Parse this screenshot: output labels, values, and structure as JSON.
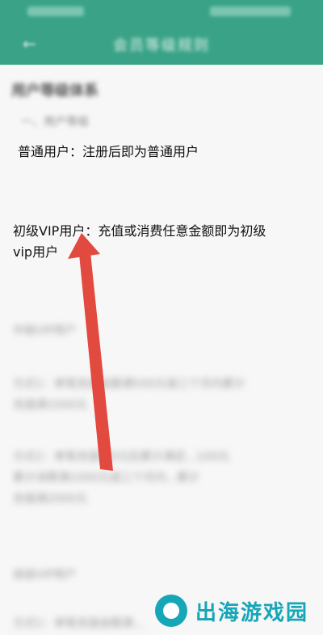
{
  "app": {
    "title": "会员等级规则"
  },
  "content": {
    "section_title": "用户等级体系",
    "subsection": "一、用户等级",
    "normal_user": "普通用户：注册后即为普通用户",
    "vip1_line1": "初级VIP用户：充值或消费任意金额即为初级",
    "vip1_line2": "vip用户",
    "mid_vip": "中级VIP用户",
    "rule1_line1": "方式1：单笔充值金额满500元或三个月内累计",
    "rule1_line2": "充值满1000元",
    "rule2_line1": "方式2：单笔充值满3元后累计满足...100元",
    "rule2_line2": "累计消费满1000元或三个月内...累计",
    "rule2_line3": "充值满2000元",
    "high_vip": "高级VIP用户",
    "rule3_line1": "方式1：单笔充值金额满..."
  },
  "watermark": {
    "text": "出海游戏园"
  }
}
